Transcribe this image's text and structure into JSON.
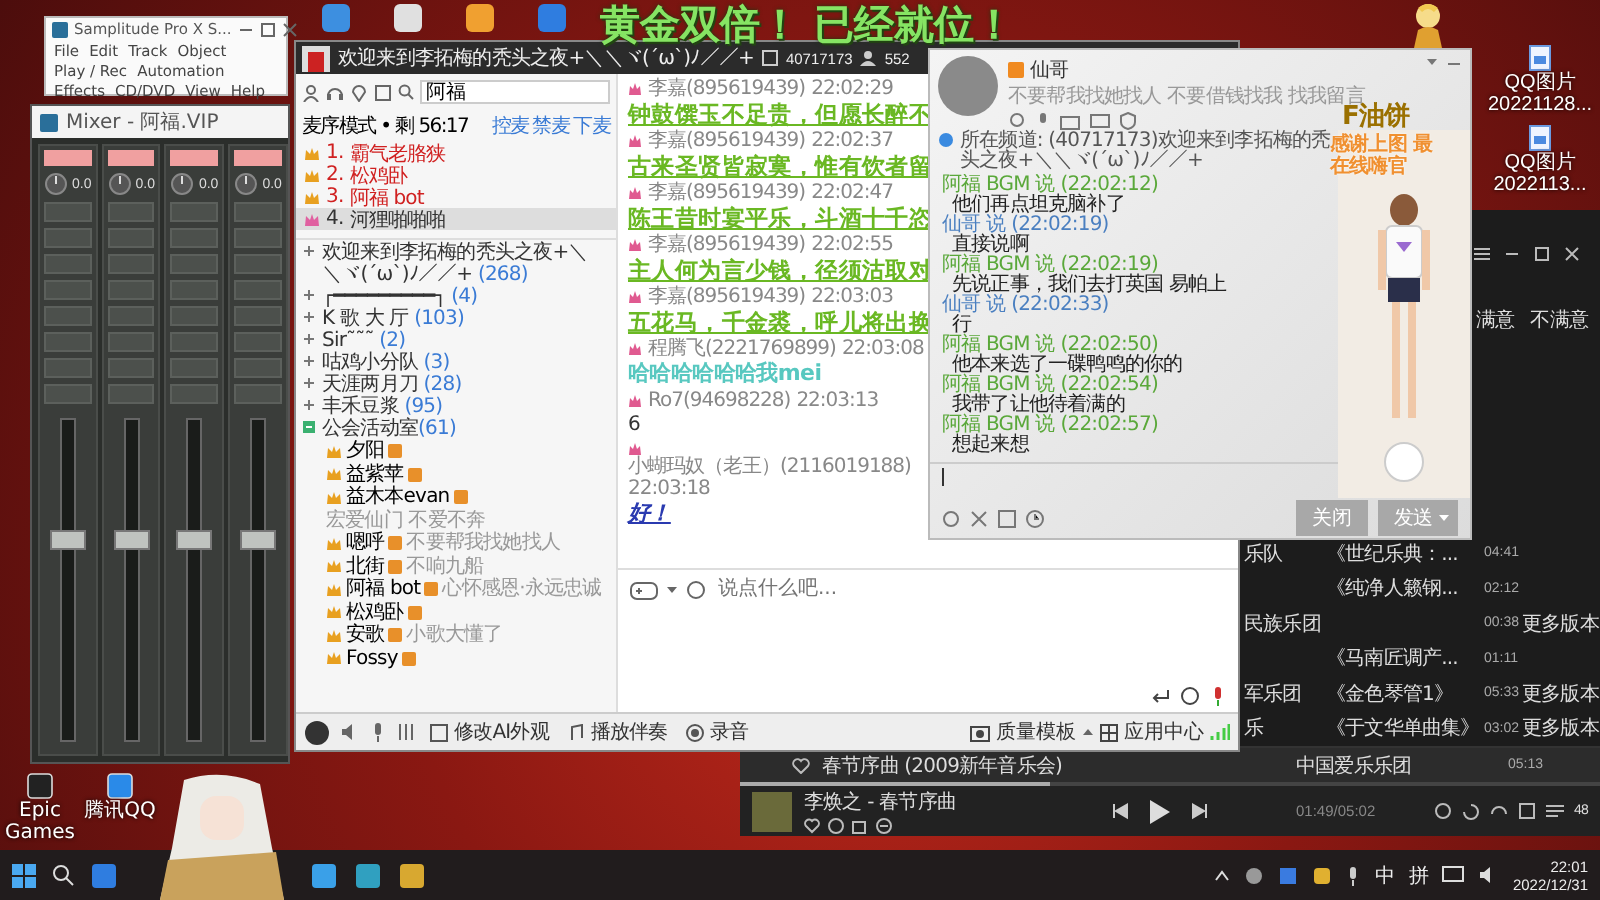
{
  "desktop": {
    "overlay_title": "黄金双倍！ 已经就位！",
    "bottom_icons": [
      {
        "label": "Epic Games"
      },
      {
        "label": "腾讯QQ"
      }
    ],
    "right_icons": [
      {
        "label": "QQ图片 20221128..."
      },
      {
        "label": "QQ图片 2022113..."
      }
    ]
  },
  "samplitude": {
    "title": "Samplitude Pro X S...",
    "menu": [
      "File",
      "Edit",
      "Track",
      "Object",
      "Play / Rec",
      "Automation",
      "Effects",
      "CD/DVD",
      "View",
      "Help"
    ]
  },
  "mixer": {
    "title": "Mixer - 阿福.VIP",
    "channels": [
      {
        "gain": "0.0",
        "level": 0.62
      },
      {
        "gain": "0.0",
        "level": 0.62
      },
      {
        "gain": "0.0",
        "level": 0.62
      },
      {
        "gain": "0.0",
        "level": 0.62
      }
    ]
  },
  "yy": {
    "title": "欢迎来到李拓梅的秃头之夜+＼＼ヾ(´ω`)ﾉ／／+",
    "channel_id": "40717173",
    "online": "552",
    "search": {
      "value": "阿福"
    },
    "mode": "麦序模式 • 剩 56:17",
    "mic_actions": [
      "控麦",
      "禁麦",
      "下麦"
    ],
    "mic_queue": [
      {
        "number": "1.",
        "name": "霸气老胳狭",
        "selected": false
      },
      {
        "number": "2.",
        "name": "松鸡卧",
        "selected": false
      },
      {
        "number": "3.",
        "name": "阿福 bot",
        "selected": false
      },
      {
        "number": "4.",
        "name": "河狸啪啪啪",
        "selected": true
      }
    ],
    "channels": [
      {
        "name": "欢迎来到李拓梅的秃头之夜+＼＼ヾ(´ω`)ﾉ／／+",
        "count": "(268)",
        "expanded": false
      },
      {
        "name": "┌━━━━━━━━━┐",
        "count": "(4)",
        "expanded": false
      },
      {
        "name": "K 歌 大 厅",
        "count": "(103)",
        "expanded": false
      },
      {
        "name": "Sir˜˜˜",
        "count": "(2)",
        "expanded": false
      },
      {
        "name": "咕鸡小分队",
        "count": "(3)",
        "expanded": false
      },
      {
        "name": "天涯两月刀",
        "count": "(28)",
        "expanded": false
      },
      {
        "name": "丰禾豆浆",
        "count": "(95)",
        "expanded": false
      }
    ],
    "guild_room": {
      "name": "公会活动室",
      "count": "(61)",
      "expanded": true,
      "members": [
        {
          "name": "夕阳"
        },
        {
          "name": "益紫苹"
        },
        {
          "name": "益木本evan",
          "signature": "宏爱仙门 不爱不奔"
        },
        {
          "name": "嗯呼",
          "signature": "不要帮我找她找人"
        },
        {
          "name": "北街",
          "signature": "不响九船"
        },
        {
          "name": "阿福 bot",
          "signature": "心怀感恩·永远忠诚"
        },
        {
          "name": "松鸡卧"
        },
        {
          "name": "安歌",
          "signature": "小歌大懂了"
        },
        {
          "name": "Fossy"
        }
      ]
    },
    "messages": [
      {
        "sender": "李嘉(895619439)",
        "time": "22:02:29",
        "text": "钟鼓馔玉不足贵，但愿长醉不",
        "kind": "poem"
      },
      {
        "sender": "李嘉(895619439)",
        "time": "22:02:37",
        "text": "古来圣贤皆寂寞，惟有饮者留",
        "kind": "poem"
      },
      {
        "sender": "李嘉(895619439)",
        "time": "22:02:47",
        "text": "陈王昔时宴平乐，斗酒十千恣",
        "kind": "poem"
      },
      {
        "sender": "李嘉(895619439)",
        "time": "22:02:55",
        "text": "主人何为言少钱，径须沽取对",
        "kind": "poem"
      },
      {
        "sender": "李嘉(895619439)",
        "time": "22:03:03",
        "text": "五花马，千金裘，呼儿将出换",
        "kind": "poem"
      },
      {
        "sender": "程腾飞(2221769899)",
        "time": "22:03:08",
        "text": "哈哈哈哈哈哈我mei",
        "kind": "cyan"
      },
      {
        "sender": "Ro7(94698228)",
        "time": "22:03:13",
        "text": "6",
        "kind": "plain"
      },
      {
        "sender": "小蝴玛奴（老王）(2116019188)",
        "time": "22:03:18",
        "text": "好！",
        "kind": "emphasis"
      }
    ],
    "input": {
      "placeholder": "说点什么吧..."
    },
    "toolbar": [
      "修改AI外观",
      "播放伴奏",
      "录音"
    ],
    "status": [
      "质量模板",
      "应用中心"
    ]
  },
  "private_chat": {
    "name": "仙哥",
    "signature": "不要帮我找她找人 不要借钱找我 找我留言",
    "notice": "所在频道: (40717173)欢迎来到李拓梅的秃头之夜+＼＼ヾ(´ω`)ﾉ／／+",
    "messages": [
      {
        "sender": "阿福 BGM 说",
        "time": "(22:02:12)",
        "text": "他们再点坦克脑补了",
        "self": true
      },
      {
        "sender": "仙哥 说",
        "time": "(22:02:19)",
        "text": "直接说啊",
        "self": false
      },
      {
        "sender": "阿福 BGM 说",
        "time": "(22:02:19)",
        "text": "先说正事，我们去打英国 易帕上",
        "self": true
      },
      {
        "sender": "仙哥 说",
        "time": "(22:02:33)",
        "text": "行",
        "self": false
      },
      {
        "sender": "阿福 BGM 说",
        "time": "(22:02:50)",
        "text": "他本来选了一碟鸭鸣的你的",
        "self": true
      },
      {
        "sender": "阿福 BGM 说",
        "time": "(22:02:54)",
        "text": "我带了让他待着满的",
        "self": true
      },
      {
        "sender": "阿福 BGM 说",
        "time": "(22:02:57)",
        "text": "想起来想",
        "self": true
      }
    ],
    "buttons": [
      "关闭",
      "发送"
    ],
    "sticker_name": "F油饼",
    "sticker_text": "感谢上图 最在线嗨官"
  },
  "music": {
    "feedback": [
      "满意",
      "不满意"
    ],
    "rows": [
      {
        "artist": "乐队",
        "album": "《世纪乐典：...",
        "duration": "04:41",
        "selected": false
      },
      {
        "album": "《纯净人籁钢...",
        "duration": "02:12",
        "selected": false
      },
      {
        "artist": "民族乐团",
        "duration": "00:38",
        "more": "更多版本",
        "selected": false
      },
      {
        "album": "《马南匠调产...",
        "duration": "01:11",
        "selected": false
      },
      {
        "artist": "军乐团",
        "album": "《金色琴管1》",
        "duration": "05:33",
        "more": "更多版本",
        "selected": false
      },
      {
        "artist": "乐",
        "album": "《于文华单曲集》",
        "duration": "03:02",
        "more": "更多版本",
        "selected": false
      }
    ],
    "playing_row": {
      "title": "春节序曲 (2009新年音乐会)",
      "artist": "中国爱乐乐团",
      "duration": "05:13",
      "selected": true
    },
    "player": {
      "title": "李焕之 - 春节序曲",
      "time": "01:49/05:02",
      "playlist_count": "48",
      "level": 0.36
    }
  },
  "taskbar": {
    "tray": [
      "中",
      "拼"
    ],
    "time": "22:01",
    "date": "2022/12/31"
  }
}
